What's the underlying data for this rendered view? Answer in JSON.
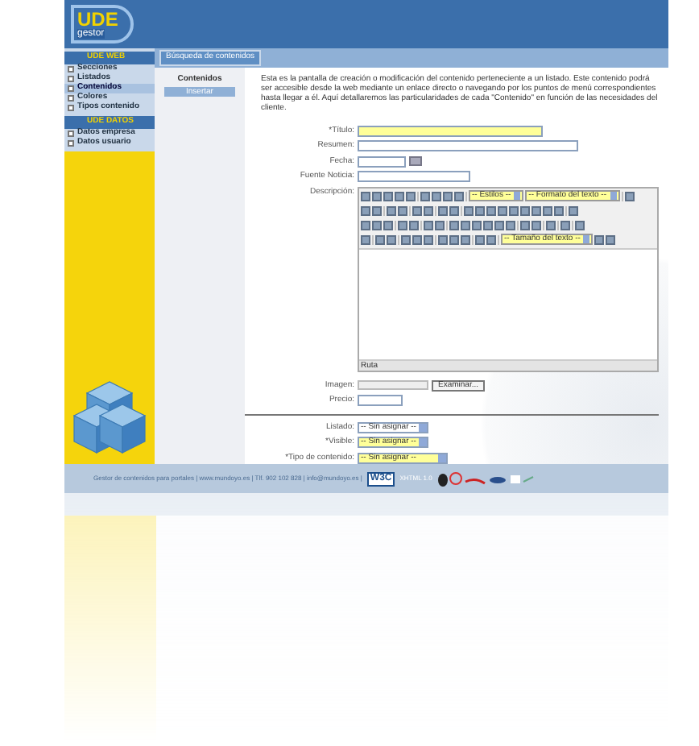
{
  "logo": {
    "text": "UDE",
    "subtext": "gestor"
  },
  "sidebar": {
    "sections": [
      {
        "title": "UDE WEB",
        "items": [
          {
            "label": "Secciones",
            "selected": false
          },
          {
            "label": "Listados",
            "selected": false
          },
          {
            "label": "Contenidos",
            "selected": true
          },
          {
            "label": "Colores",
            "selected": false
          },
          {
            "label": "Tipos contenido",
            "selected": false
          }
        ]
      },
      {
        "title": "UDE DATOS",
        "items": [
          {
            "label": "Datos empresa",
            "selected": false
          },
          {
            "label": "Datos usuario",
            "selected": false
          }
        ]
      }
    ]
  },
  "top_button": "Búsqueda de contenidos",
  "subnav": {
    "title": "Contenidos",
    "button": "Insertar"
  },
  "intro": "Esta es la pantalla de creación o modificación del contenido perteneciente a un listado. Este contenido podrá ser accesible desde la web mediante un enlace directo o navegando por los puntos de menú correspondientes hasta llegar a él. Aquí detallaremos las particularidades de cada \"Contenido\" en función de las necesidades del cliente.",
  "fields": [
    {
      "kind": "text",
      "label": "*Título:",
      "required": true
    },
    {
      "kind": "text",
      "label": "Resumen:",
      "required": false
    },
    {
      "kind": "date",
      "label": "Fecha:",
      "required": false
    },
    {
      "kind": "text",
      "label": "Fuente Noticia:",
      "required": false
    }
  ],
  "editor": {
    "label": "Descripción:",
    "selects": [
      "-- Estilos --",
      "-- Formato del texto --",
      "-- Tamaño del texto --"
    ],
    "path_label": "Ruta"
  },
  "image": {
    "label": "Imagen:",
    "button": "Examinar..."
  },
  "price": {
    "label": "Precio:"
  },
  "selects": [
    {
      "label": "Listado:",
      "value": "-- Sin asignar --",
      "required": false
    },
    {
      "label": "*Visible:",
      "value": "-- Sin asignar --",
      "required": true
    },
    {
      "label": "*Tipo de contenido:",
      "value": "-- Sin asignar --",
      "required": true
    }
  ],
  "footer": {
    "text": "Gestor de contenidos para portales | www.mundoyo.es | Tlf. 902 102 828 | info@mundoyo.es |",
    "badge": "W3C",
    "badge_text": "XHTML 1.0"
  }
}
